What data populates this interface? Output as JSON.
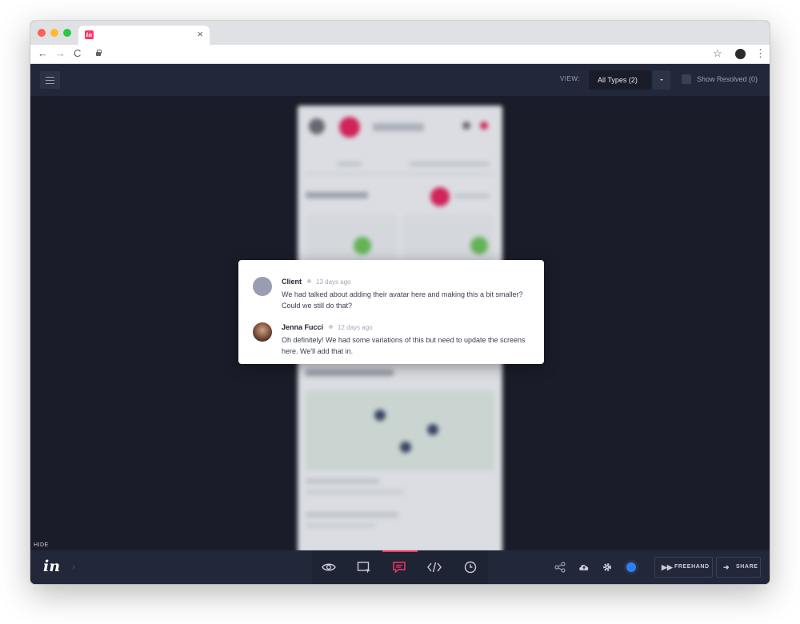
{
  "browser": {
    "tab_favicon_text": "in",
    "tab_close": "×",
    "nav_back": "←",
    "nav_forward": "→",
    "nav_reload": "C",
    "bookmark_star": "☆",
    "menu_dots": "⋮"
  },
  "header": {
    "view_label": "VIEW:",
    "view_select_value": "All Types (2)",
    "show_resolved_label": "Show Resolved (0)",
    "show_resolved_checked": false
  },
  "comments": [
    {
      "author": "Client",
      "time": "13 days ago",
      "text": "We had talked about adding their avatar here and making this a bit smaller? Could we still do that?"
    },
    {
      "author": "Jenna Fucci",
      "time": "12 days ago",
      "text": "Oh definitely! We had some variations of this but need to update the screens here. We'll add that in."
    }
  ],
  "bottom_bar": {
    "hide_label": "HIDE",
    "logo_text": "in",
    "chevron": "›",
    "modes": [
      "preview-icon",
      "inspect-icon",
      "comment-icon",
      "code-icon",
      "history-icon"
    ],
    "active_mode": "comment-icon",
    "freehand_label": "FREEHAND",
    "share_label": "SHARE"
  },
  "colors": {
    "accent": "#ff3366",
    "status_dot": "#2d7ff9",
    "header_bg": "#22273a",
    "canvas_bg": "#1a1d29"
  }
}
